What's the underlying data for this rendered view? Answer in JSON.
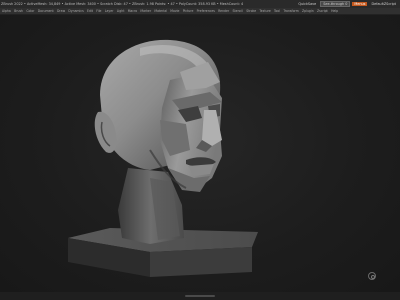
{
  "window": {
    "title": "ZBrush 2022 • ActiveMesh: 34,849 • Active Mesh: 3400 • Scratch Disk: 47 • ZBrush: 1.98 Points: • 47 • PolyCount: 358.93 KB • MeshCount: 4",
    "right_labels": [
      "QuickSave",
      "See-through 0",
      "Menus",
      "DefaultZScript"
    ]
  },
  "menubar": {
    "items": [
      "Alpha",
      "Brush",
      "Color",
      "Document",
      "Draw",
      "Dynamics",
      "Edit",
      "File",
      "Layer",
      "Light",
      "Macro",
      "Marker",
      "Material",
      "Movie",
      "Picture",
      "Preferences",
      "Render",
      "Stencil",
      "Stroke",
      "Texture",
      "Tool",
      "Transform",
      "Zplugin",
      "Zscript",
      "Help"
    ]
  },
  "colors": {
    "accent": "#c4581d",
    "viewport_bg": "#1b1b1b"
  },
  "scene": {
    "model": "sculpted head bust on pedestal"
  }
}
